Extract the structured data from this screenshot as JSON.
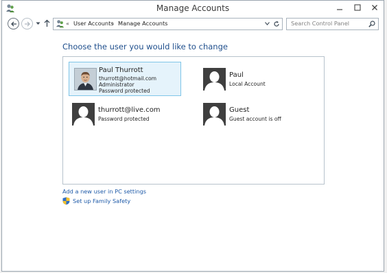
{
  "window": {
    "title": "Manage Accounts"
  },
  "nav": {
    "breadcrumb_prefix": "«",
    "breadcrumb": [
      "User Accounts",
      "Manage Accounts"
    ],
    "breadcrumb_separator": "›",
    "search_placeholder": "Search Control Panel"
  },
  "main": {
    "heading": "Choose the user you would like to change",
    "accounts": [
      {
        "name": "Paul Thurrott",
        "lines": [
          "thurrott@hotmail.com",
          "Administrator",
          "Password protected"
        ],
        "avatar": "photo",
        "selected": true
      },
      {
        "name": "Paul",
        "lines": [
          "Local Account"
        ],
        "avatar": "silhouette",
        "selected": false
      },
      {
        "name": "thurrott@live.com",
        "lines": [
          "Password protected"
        ],
        "avatar": "silhouette",
        "selected": false
      },
      {
        "name": "Guest",
        "lines": [
          "Guest account is off"
        ],
        "avatar": "silhouette",
        "selected": false
      }
    ],
    "add_user_link": "Add a new user in PC settings",
    "family_safety_link": "Set up Family Safety"
  },
  "icons": {
    "app": "user-accounts-icon",
    "back": "back-arrow-icon",
    "forward": "forward-arrow-icon",
    "recent": "chevron-down-icon",
    "up": "up-arrow-icon",
    "refresh": "refresh-icon",
    "search": "search-icon",
    "shield": "shield-icon"
  },
  "colors": {
    "heading": "#1e4e8c",
    "link": "#1e5aa8",
    "selection_fill": "#e5f3fb",
    "selection_border": "#7fc5e8",
    "avatar": "#3f3f3f"
  }
}
